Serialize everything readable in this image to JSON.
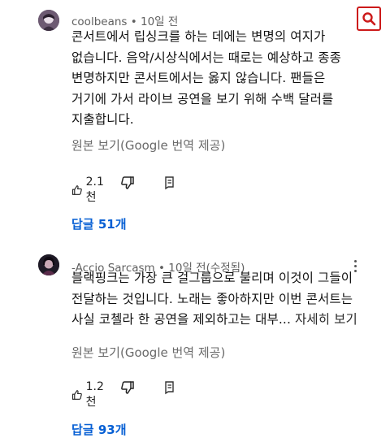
{
  "comments": [
    {
      "author": "coolbeans",
      "time": "10일 전",
      "edited": "",
      "text_lines": [
        "콘서트에서 립싱크를 하는 데에는 변명의 여지가",
        "없습니다. 음악/시상식에서는 때로는 예상하고 종종",
        "변명하지만 콘서트에서는 옳지 않습니다. 팬들은",
        "거기에 가서 라이브 공연을 보기 위해 수백 달러를",
        "지출합니다."
      ],
      "view_original": "원본 보기(Google 번역 제공)",
      "likes": "2.1천",
      "replies_label": "답글 51개"
    },
    {
      "author": "-Accio Sarcasm",
      "time": "10일 전",
      "edited": "(수정됨)",
      "text_lines": [
        "블랙핑크는 가장 큰 걸그룹으로 불리며 이것이 그들이",
        "전달하는 것입니다. 노래는 좋아하지만 이번 콘서트는",
        "사실 코첼라 한 공연을 제외하고는 대부..."
      ],
      "read_more": "자세히 보기",
      "view_original": "원본 보기(Google 번역 제공)",
      "likes": "1.2천",
      "replies_label": "답글 93개"
    }
  ],
  "colors": {
    "link_blue": "#065fd4",
    "search_border": "#cc1a1a",
    "meta_gray": "#5f5f5f"
  },
  "icons": [
    "search-icon",
    "thumb-up-icon",
    "thumb-down-icon",
    "reply-icon",
    "more-vert-icon"
  ]
}
